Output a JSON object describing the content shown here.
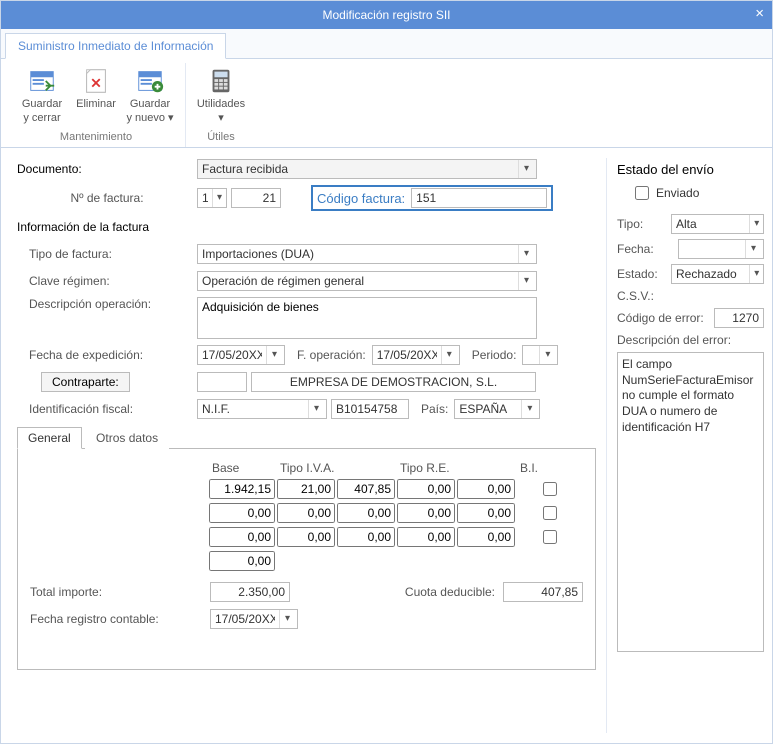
{
  "title": "Modificación registro SII",
  "tabstrip": {
    "active": "Suministro Inmediato de Información"
  },
  "ribbon": {
    "group_mant": "Mantenimiento",
    "group_util": "Útiles",
    "btn_save_close1": "Guardar",
    "btn_save_close2": "y cerrar",
    "btn_delete": "Eliminar",
    "btn_save_new1": "Guardar",
    "btn_save_new2": "y nuevo",
    "btn_util": "Utilidades"
  },
  "form": {
    "documento_lbl": "Documento:",
    "documento_val": "Factura recibida",
    "nfact_lbl": "Nº de factura:",
    "nfact_prefix": "1",
    "nfact_num": "21",
    "codigo_lbl": "Código factura:",
    "codigo_val": "151",
    "info_section": "Información de la factura",
    "tipo_lbl": "Tipo de factura:",
    "tipo_val": "Importaciones (DUA)",
    "clave_lbl": "Clave régimen:",
    "clave_val": "Operación de régimen general",
    "desc_lbl": "Descripción operación:",
    "desc_val": "Adquisición de bienes",
    "fexp_lbl": "Fecha de expedición:",
    "fexp_val": "17/05/20XX",
    "fop_lbl": "F. operación:",
    "fop_val": "17/05/20XX",
    "periodo_lbl": "Periodo:",
    "periodo_val": "",
    "contra_btn": "Contraparte:",
    "contra_code": "",
    "contra_name": "EMPRESA DE DEMOSTRACION, S.L.",
    "idfiscal_lbl": "Identificación fiscal:",
    "idfiscal_tipo": "N.I.F.",
    "idfiscal_num": "B10154758",
    "pais_lbl": "País:",
    "pais_val": "ESPAÑA"
  },
  "tabs2": {
    "general": "General",
    "otros": "Otros datos"
  },
  "tax": {
    "h_base": "Base",
    "h_tipoiva": "Tipo I.V.A.",
    "h_tipore": "Tipo R.E.",
    "h_bi": "B.I.",
    "rows": [
      {
        "base": "1.942,15",
        "tiva": "21,00",
        "civa": "407,85",
        "tre": "0,00",
        "cre": "0,00"
      },
      {
        "base": "0,00",
        "tiva": "0,00",
        "civa": "0,00",
        "tre": "0,00",
        "cre": "0,00"
      },
      {
        "base": "0,00",
        "tiva": "0,00",
        "civa": "0,00",
        "tre": "0,00",
        "cre": "0,00"
      }
    ],
    "base_total": "0,00",
    "total_lbl": "Total importe:",
    "total_val": "2.350,00",
    "cuota_lbl": "Cuota deducible:",
    "cuota_val": "407,85",
    "freg_lbl": "Fecha registro contable:",
    "freg_val": "17/05/20XX"
  },
  "envio": {
    "title": "Estado del envío",
    "enviado_lbl": "Enviado",
    "tipo_lbl": "Tipo:",
    "tipo_val": "Alta",
    "fecha_lbl": "Fecha:",
    "fecha_val": "",
    "estado_lbl": "Estado:",
    "estado_val": "Rechazado",
    "csv_lbl": "C.S.V.:",
    "coderr_lbl": "Código de error:",
    "coderr_val": "1270",
    "descerr_lbl": "Descripción del error:",
    "descerr_val": "El campo NumSerieFacturaEmisor no cumple el formato DUA o numero de identificación H7"
  }
}
